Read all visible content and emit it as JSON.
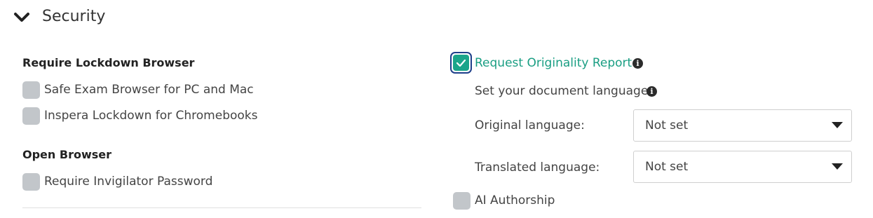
{
  "section": {
    "title": "Security",
    "icon": "chevron-down-icon"
  },
  "lockdown": {
    "title": "Require Lockdown Browser",
    "options": [
      {
        "label": "Safe Exam Browser for PC and Mac",
        "checked": false
      },
      {
        "label": "Inspera Lockdown for Chromebooks",
        "checked": false
      }
    ]
  },
  "open_browser": {
    "title": "Open Browser",
    "options": [
      {
        "label": "Require Invigilator Password",
        "checked": false
      }
    ]
  },
  "originality": {
    "label": "Request Originality Report",
    "checked": true,
    "info_icon": "info-icon",
    "doc_language_label": "Set your document language",
    "original_language": {
      "label": "Original language:",
      "value": "Not set"
    },
    "translated_language": {
      "label": "Translated language:",
      "value": "Not set"
    }
  },
  "ai_authorship": {
    "label": "AI Authorship",
    "checked": false
  },
  "colors": {
    "accent": "#1ba58a",
    "accent_text": "#1a9e83",
    "focus_ring": "#1e3f8a",
    "unchecked_box": "#c2c6ca"
  }
}
